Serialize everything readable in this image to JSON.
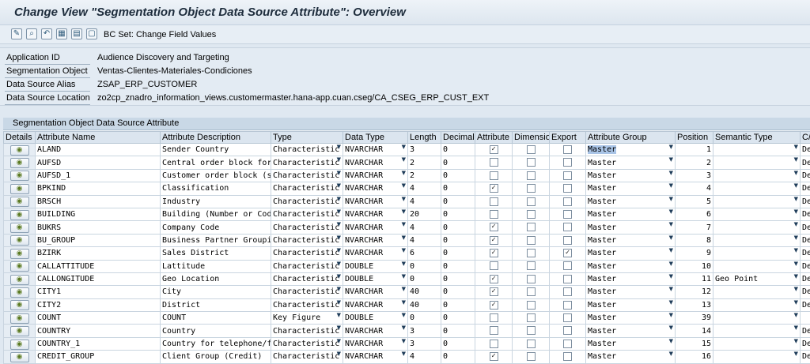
{
  "window": {
    "title": "Change View \"Segmentation Object Data Source Attribute\": Overview"
  },
  "toolbar": {
    "icons": [
      "display-change-icon",
      "find-icon",
      "undo-icon",
      "select-all-icon",
      "select-block-icon",
      "deselect-all-icon"
    ],
    "bc_set_label": "BC Set: Change Field Values"
  },
  "header": {
    "fields": [
      {
        "label": "Application ID",
        "value": "Audience Discovery and Targeting"
      },
      {
        "label": "Segmentation Object",
        "value": "Ventas-Clientes-Materiales-Condiciones"
      },
      {
        "label": "Data Source Alias",
        "value": "ZSAP_ERP_CUSTOMER"
      },
      {
        "label": "Data Source Location",
        "value": "zo2cp_znadro_information_views.customermaster.hana-app.cuan.cseg/CA_CSEG_ERP_CUST_EXT"
      }
    ]
  },
  "table": {
    "caption": "Segmentation Object Data Source Attribute",
    "columns": [
      "Details",
      "Attribute Name",
      "Attribute Description",
      "Type",
      "Data Type",
      "Length",
      "Decimals",
      "Attribute",
      "Dimension",
      "Export",
      "Attribute Group",
      "Position",
      "Semantic Type",
      "C/"
    ],
    "rows": [
      {
        "name": "ALAND",
        "desc": "Sender Country",
        "type": "Characteristic",
        "dtype": "NVARCHAR",
        "length": "3",
        "decimals": "0",
        "attribute": true,
        "dimension": false,
        "export": false,
        "group": "Master",
        "position": "1",
        "semantic": "",
        "c": "De"
      },
      {
        "name": "AUFSD",
        "desc": "Central order block for …",
        "type": "Characteristic",
        "dtype": "NVARCHAR",
        "length": "2",
        "decimals": "0",
        "attribute": false,
        "dimension": false,
        "export": false,
        "group": "Master",
        "position": "2",
        "semantic": "",
        "c": "De"
      },
      {
        "name": "AUFSD_1",
        "desc": "Customer order block (sa…",
        "type": "Characteristic",
        "dtype": "NVARCHAR",
        "length": "2",
        "decimals": "0",
        "attribute": false,
        "dimension": false,
        "export": false,
        "group": "Master",
        "position": "3",
        "semantic": "",
        "c": "De"
      },
      {
        "name": "BPKIND",
        "desc": "Classification",
        "type": "Characteristic",
        "dtype": "NVARCHAR",
        "length": "4",
        "decimals": "0",
        "attribute": true,
        "dimension": false,
        "export": false,
        "group": "Master",
        "position": "4",
        "semantic": "",
        "c": "De"
      },
      {
        "name": "BRSCH",
        "desc": "Industry",
        "type": "Characteristic",
        "dtype": "NVARCHAR",
        "length": "4",
        "decimals": "0",
        "attribute": false,
        "dimension": false,
        "export": false,
        "group": "Master",
        "position": "5",
        "semantic": "",
        "c": "De"
      },
      {
        "name": "BUILDING",
        "desc": "Building (Number or Code)",
        "type": "Characteristic",
        "dtype": "NVARCHAR",
        "length": "20",
        "decimals": "0",
        "attribute": false,
        "dimension": false,
        "export": false,
        "group": "Master",
        "position": "6",
        "semantic": "",
        "c": "De"
      },
      {
        "name": "BUKRS",
        "desc": "Company Code",
        "type": "Characteristic",
        "dtype": "NVARCHAR",
        "length": "4",
        "decimals": "0",
        "attribute": true,
        "dimension": false,
        "export": false,
        "group": "Master",
        "position": "7",
        "semantic": "",
        "c": "De"
      },
      {
        "name": "BU_GROUP",
        "desc": "Business Partner Grouping",
        "type": "Characteristic",
        "dtype": "NVARCHAR",
        "length": "4",
        "decimals": "0",
        "attribute": true,
        "dimension": false,
        "export": false,
        "group": "Master",
        "position": "8",
        "semantic": "",
        "c": "De"
      },
      {
        "name": "BZIRK",
        "desc": "Sales District",
        "type": "Characteristic",
        "dtype": "NVARCHAR",
        "length": "6",
        "decimals": "0",
        "attribute": true,
        "dimension": false,
        "export": true,
        "group": "Master",
        "position": "9",
        "semantic": "",
        "c": "De"
      },
      {
        "name": "CALLATTITUDE",
        "desc": "Lattitude",
        "type": "Characteristic",
        "dtype": "DOUBLE",
        "length": "0",
        "decimals": "0",
        "attribute": false,
        "dimension": false,
        "export": false,
        "group": "Master",
        "position": "10",
        "semantic": "",
        "c": "De"
      },
      {
        "name": "CALLONGITUDE",
        "desc": "Geo Location",
        "type": "Characteristic",
        "dtype": "DOUBLE",
        "length": "0",
        "decimals": "0",
        "attribute": true,
        "dimension": false,
        "export": false,
        "group": "Master",
        "position": "11",
        "semantic": "Geo Point",
        "c": "De"
      },
      {
        "name": "CITY1",
        "desc": "City",
        "type": "Characteristic",
        "dtype": "NVARCHAR",
        "length": "40",
        "decimals": "0",
        "attribute": true,
        "dimension": false,
        "export": false,
        "group": "Master",
        "position": "12",
        "semantic": "",
        "c": "De"
      },
      {
        "name": "CITY2",
        "desc": "District",
        "type": "Characteristic",
        "dtype": "NVARCHAR",
        "length": "40",
        "decimals": "0",
        "attribute": true,
        "dimension": false,
        "export": false,
        "group": "Master",
        "position": "13",
        "semantic": "",
        "c": "De"
      },
      {
        "name": "COUNT",
        "desc": "COUNT",
        "type": "Key Figure",
        "dtype": "DOUBLE",
        "length": "0",
        "decimals": "0",
        "attribute": false,
        "dimension": false,
        "export": false,
        "group": "Master",
        "position": "39",
        "semantic": "",
        "c": ""
      },
      {
        "name": "COUNTRY",
        "desc": "Country",
        "type": "Characteristic",
        "dtype": "NVARCHAR",
        "length": "3",
        "decimals": "0",
        "attribute": false,
        "dimension": false,
        "export": false,
        "group": "Master",
        "position": "14",
        "semantic": "",
        "c": "De"
      },
      {
        "name": "COUNTRY_1",
        "desc": "Country for telephone/fa…",
        "type": "Characteristic",
        "dtype": "NVARCHAR",
        "length": "3",
        "decimals": "0",
        "attribute": false,
        "dimension": false,
        "export": false,
        "group": "Master",
        "position": "15",
        "semantic": "",
        "c": "De"
      },
      {
        "name": "CREDIT_GROUP",
        "desc": "Client Group (Credit)",
        "type": "Characteristic",
        "dtype": "NVARCHAR",
        "length": "4",
        "decimals": "0",
        "attribute": true,
        "dimension": false,
        "export": false,
        "group": "Master",
        "position": "16",
        "semantic": "",
        "c": "De"
      }
    ]
  }
}
